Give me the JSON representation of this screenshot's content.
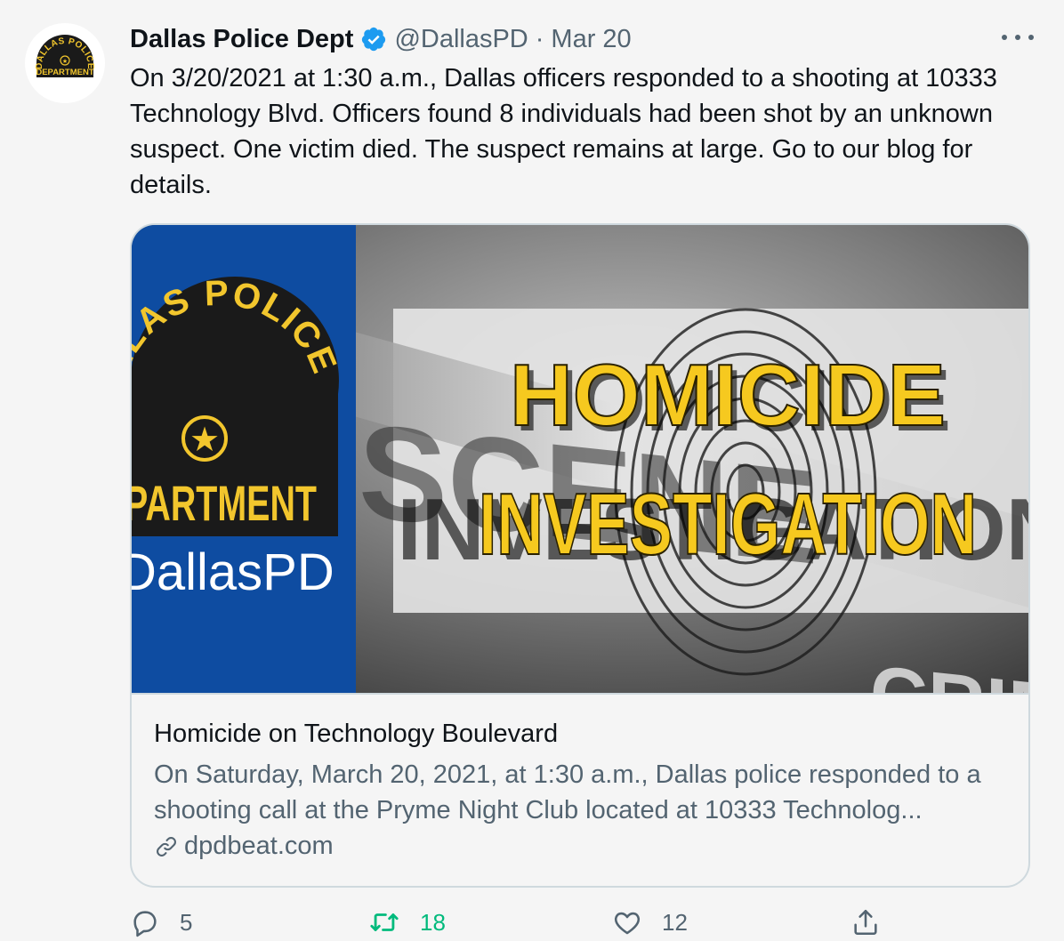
{
  "tweet": {
    "author_name": "Dallas Police Dept",
    "handle": "@DallasPD",
    "separator": "·",
    "date": "Mar 20",
    "text": "On 3/20/2021 at 1:30 a.m., Dallas officers responded to a shooting at 10333 Technology Blvd. Officers found 8 individuals had been shot by an unknown suspect. One victim died. The suspect remains at large. Go to our blog for details.",
    "verified": true
  },
  "avatar": {
    "badge_text_top": "DALLAS POLICE",
    "badge_text_bottom": "DEPARTMENT",
    "badge_color": "#1a1a1a",
    "badge_accent": "#f2c62d"
  },
  "card": {
    "image": {
      "badge_text_top": "LLAS POLICE",
      "badge_text_bottom": "PARTMENT",
      "brand_text": "DallasPD",
      "headline_line1": "HOMICIDE",
      "headline_line2": "INVESTIGATION",
      "tape_text": "SCENE",
      "tape_text_right": "CRIME",
      "panel_color": "#0e4ca1",
      "headline_color": "#f6c91f"
    },
    "title": "Homicide on Technology Boulevard",
    "description": "On Saturday, March 20, 2021, at 1:30 a.m., Dallas police responded to a shooting call at the Pryme Night Club located at 10333 Technolog...",
    "domain": "dpdbeat.com"
  },
  "actions": {
    "reply_count": "5",
    "retweet_count": "18",
    "like_count": "12",
    "reply_icon": "reply-icon",
    "retweet_icon": "retweet-icon",
    "like_icon": "heart-icon",
    "share_icon": "share-icon",
    "retweet_active_color": "#00ba7c"
  },
  "colors": {
    "background": "#f5f5f5",
    "primary_text": "#0f1419",
    "secondary_text": "#536471",
    "border": "#cfd9de",
    "verified_blue": "#1d9bf0"
  }
}
